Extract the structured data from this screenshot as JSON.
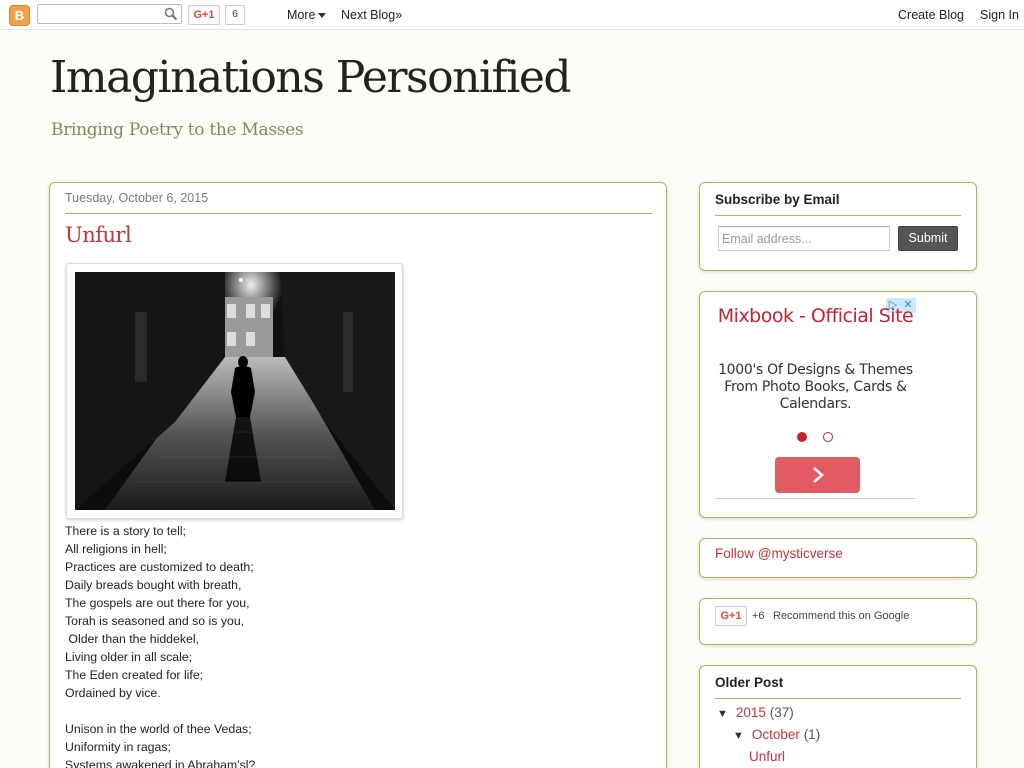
{
  "navbar": {
    "logo_letter": "B",
    "search_placeholder": "",
    "gplus_label": "G+1",
    "gplus_count": "6",
    "more_label": "More",
    "next_blog_label": "Next Blog»",
    "create_blog_label": "Create Blog",
    "sign_in_label": "Sign In"
  },
  "header": {
    "title": "Imaginations Personified",
    "description": "Bringing Poetry to the Masses"
  },
  "post": {
    "date": "Tuesday, October 6, 2015",
    "title": "Unfurl",
    "image_icon": "alley-silhouette-photo",
    "lines": [
      "There is a story to tell;",
      "All religions in hell;",
      "Practices are customized to death;",
      "Daily breads bought with breath,",
      "The gospels are out there for you,",
      "Torah is seasoned and so is you,",
      " Older than the hiddekel,",
      "Living older in all scale;",
      "The Eden created for life;",
      "Ordained by vice.",
      "",
      "Unison in the world of thee Vedas;",
      "Uniformity in ragas;",
      "Systems awakened in Abraham'sl?"
    ]
  },
  "subscribe": {
    "heading": "Subscribe by Email",
    "placeholder": "Email address...",
    "submit_label": "Submit"
  },
  "ad": {
    "headline": "Mixbook - Official Site",
    "body": "1000's Of Designs & Themes From Photo Books, Cards & Calendars.",
    "active_color": "#c8232c"
  },
  "follow": {
    "label": "Follow @mysticverse"
  },
  "gplus_widget": {
    "button_label": "G+1",
    "count": "+6",
    "recommend": "Recommend this on Google"
  },
  "archive": {
    "heading": "Older Post",
    "year": {
      "label": "2015",
      "count": "(37)",
      "toggle": "▼"
    },
    "month": {
      "label": "October",
      "count": "(1)",
      "toggle": "▼"
    },
    "post": "Unfurl"
  },
  "colors": {
    "accent": "#c73336",
    "border": "#a9b854",
    "description": "#7f8a5b"
  }
}
